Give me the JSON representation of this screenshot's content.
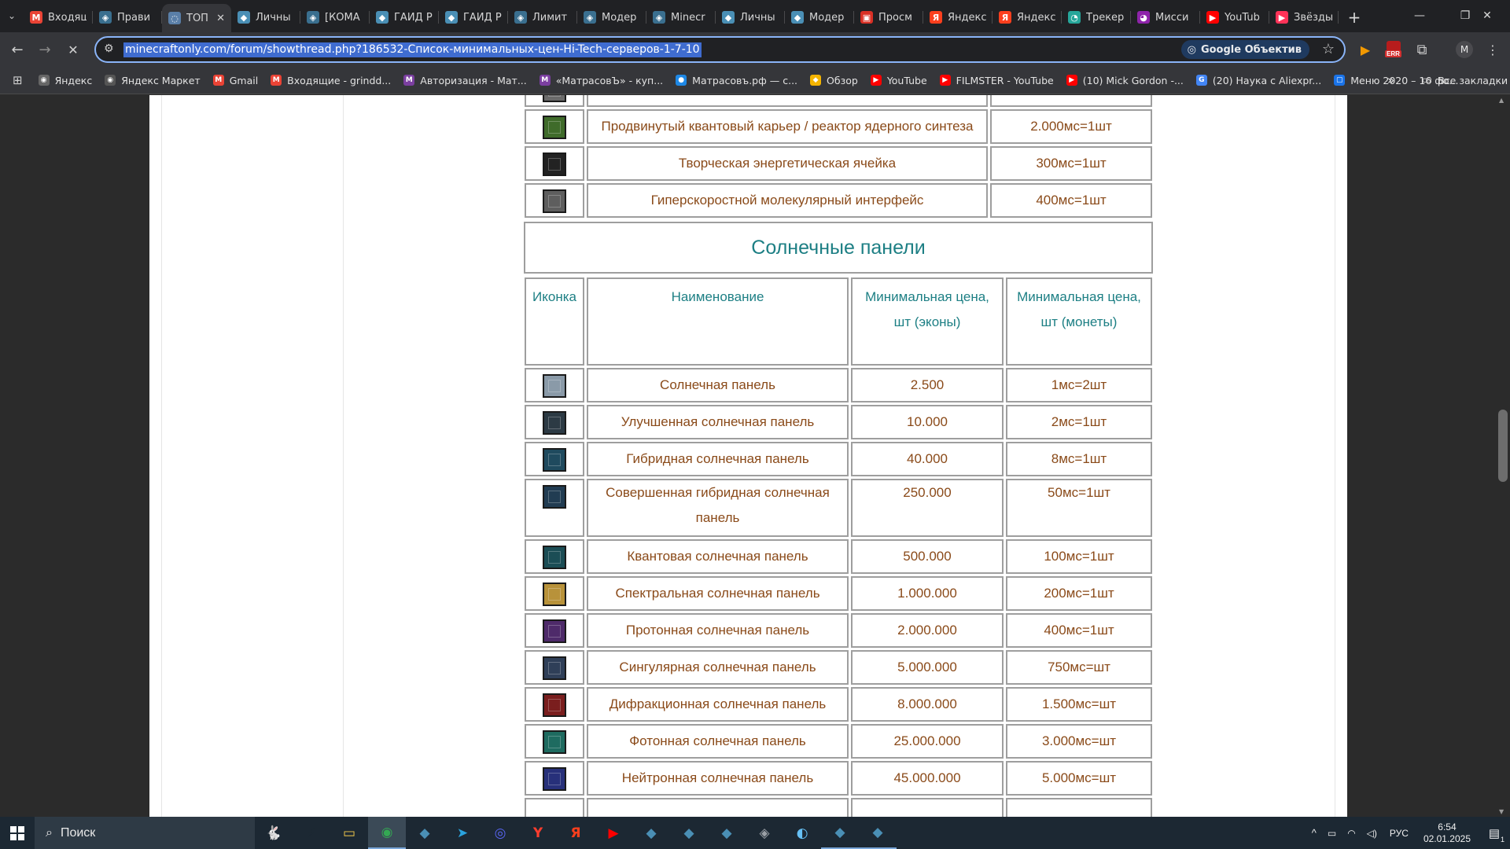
{
  "tabs": [
    {
      "label": "Входящ",
      "fav": "M",
      "color": "#ea4335"
    },
    {
      "label": "Прави",
      "fav": "◈",
      "color": "#3a6f8f"
    },
    {
      "label": "ТОП",
      "fav": "◌",
      "color": "#5a7fa8",
      "active": true
    },
    {
      "label": "Личны",
      "fav": "◆",
      "color": "#4a8fb5"
    },
    {
      "label": "[КОМА",
      "fav": "◈",
      "color": "#3a6f8f"
    },
    {
      "label": "ГАЙД Р",
      "fav": "◆",
      "color": "#4a8fb5"
    },
    {
      "label": "ГАЙД Р",
      "fav": "◆",
      "color": "#4a8fb5"
    },
    {
      "label": "Лимит",
      "fav": "◈",
      "color": "#3a6f8f"
    },
    {
      "label": "Модер",
      "fav": "◈",
      "color": "#3a6f8f"
    },
    {
      "label": "Minecr",
      "fav": "◈",
      "color": "#3a6f8f"
    },
    {
      "label": "Личны",
      "fav": "◆",
      "color": "#4a8fb5"
    },
    {
      "label": "Модер",
      "fav": "◆",
      "color": "#4a8fb5"
    },
    {
      "label": "Просм",
      "fav": "▣",
      "color": "#d93025"
    },
    {
      "label": "Яндекс",
      "fav": "Я",
      "color": "#fc3f1d"
    },
    {
      "label": "Яндекс",
      "fav": "Я",
      "color": "#fc3f1d"
    },
    {
      "label": "Трекер",
      "fav": "◔",
      "color": "#26a69a"
    },
    {
      "label": "Мисси",
      "fav": "◕",
      "color": "#8e24aa"
    },
    {
      "label": "YouTub",
      "fav": "▶",
      "color": "#ff0000"
    },
    {
      "label": "Звёзды",
      "fav": "▶",
      "color": "#ff3358"
    }
  ],
  "toolbar": {
    "url": "minecraftonly.com/forum/showthread.php?186532-Список-минимальных-цен-Hi-Tech-серверов-1-7-10",
    "lens_label": "Google Объектив",
    "profile_initial": "M",
    "ext_badge": "ERR"
  },
  "bookmarks": [
    {
      "label": "Яндекс",
      "fav": "◉",
      "color": "#666"
    },
    {
      "label": "Яндекс Маркет",
      "fav": "◉",
      "color": "#555"
    },
    {
      "label": "Gmail",
      "fav": "M",
      "color": "#ea4335"
    },
    {
      "label": "Входящие - grindd...",
      "fav": "M",
      "color": "#ea4335"
    },
    {
      "label": "Авторизация - Мат...",
      "fav": "M",
      "color": "#7b3fa0"
    },
    {
      "label": "«МатрасовЪ» - куп...",
      "fav": "M",
      "color": "#7b3fa0"
    },
    {
      "label": "Матрасовъ.рф — с...",
      "fav": "●",
      "color": "#1e88e5"
    },
    {
      "label": "Обзор",
      "fav": "◆",
      "color": "#f4b400"
    },
    {
      "label": "YouTube",
      "fav": "▶",
      "color": "#ff0000"
    },
    {
      "label": "FILMSTER - YouTube",
      "fav": "▶",
      "color": "#ff0000"
    },
    {
      "label": "(10) Mick Gordon -...",
      "fav": "▶",
      "color": "#ff0000"
    },
    {
      "label": "(20) Наука с Aliexpr...",
      "fav": "G",
      "color": "#4285f4"
    },
    {
      "label": "Меню 2020 – 16 фо...",
      "fav": "▢",
      "color": "#1a73e8"
    }
  ],
  "bookmarks_more": "»",
  "all_bookmarks": "Все закладки",
  "top_table": [
    {
      "name": "",
      "price": "",
      "color": "#6a6a6a"
    },
    {
      "name": "Продвинутый квантовый карьер / реактор ядерного синтеза",
      "price": "2.000мс=1шт",
      "color": "#3f6b2a"
    },
    {
      "name": "Творческая энергетическая ячейка",
      "price": "300мс=1шт",
      "color": "#222222"
    },
    {
      "name": "Гиперскоростной молекулярный интерфейс",
      "price": "400мс=1шт",
      "color": "#5e5e5e"
    }
  ],
  "solar": {
    "title": "Солнечные панели",
    "headers": {
      "icon": "Иконка",
      "name": "Наименование",
      "price_ecos": "Минимальная цена, шт (эконы)",
      "price_coins": "Минимальная цена, шт (монеты)"
    },
    "rows": [
      {
        "name": "Солнечная панель",
        "ecos": "2.500",
        "coins": "1мс=2шт",
        "color": "#8a9aa8"
      },
      {
        "name": "Улучшенная солнечная панель",
        "ecos": "10.000",
        "coins": "2мс=1шт",
        "color": "#2c3a44"
      },
      {
        "name": "Гибридная солнечная панель",
        "ecos": "40.000",
        "coins": "8мс=1шт",
        "color": "#1f4a5e"
      },
      {
        "name": "Совершенная гибридная солнечная панель",
        "ecos": "250.000",
        "coins": "50мс=1шт",
        "color": "#213c52"
      },
      {
        "name": "Квантовая солнечная панель",
        "ecos": "500.000",
        "coins": "100мс=1шт",
        "color": "#1b4d55"
      },
      {
        "name": "Спектральная солнечная панель",
        "ecos": "1.000.000",
        "coins": "200мс=1шт",
        "color": "#b8923a"
      },
      {
        "name": "Протонная солнечная панель",
        "ecos": "2.000.000",
        "coins": "400мс=1шт",
        "color": "#4e2a6a"
      },
      {
        "name": "Сингулярная солнечная панель",
        "ecos": "5.000.000",
        "coins": "750мс=шт",
        "color": "#2f3f58"
      },
      {
        "name": "Дифракционная солнечная панель",
        "ecos": "8.000.000",
        "coins": "1.500мс=шт",
        "color": "#7a1e1e"
      },
      {
        "name": "Фотонная солнечная панель",
        "ecos": "25.000.000",
        "coins": "3.000мс=шт",
        "color": "#1e6b60"
      },
      {
        "name": "Нейтронная солнечная панель",
        "ecos": "45.000.000",
        "coins": "5.000мс=шт",
        "color": "#27307a"
      }
    ]
  },
  "taskbar": {
    "search_label": "Поиск",
    "apps": [
      {
        "name": "taskbar-app-lively",
        "glyph": "🐇",
        "color": "#6b6f85"
      },
      {
        "name": "taskbar-app-winamp",
        "glyph": "⚡",
        "color": "#1c2833"
      },
      {
        "name": "taskbar-app-explorer",
        "glyph": "▭",
        "color": "#f2c94c"
      },
      {
        "name": "taskbar-app-chrome",
        "glyph": "◉",
        "color": "#34a853"
      },
      {
        "name": "taskbar-app-game1",
        "glyph": "◆",
        "color": "#4a8fb5"
      },
      {
        "name": "taskbar-app-telegram",
        "glyph": "➤",
        "color": "#2aa3de"
      },
      {
        "name": "taskbar-app-discord",
        "glyph": "◎",
        "color": "#5865f2"
      },
      {
        "name": "taskbar-app-yandex-browser",
        "glyph": "Y",
        "color": "#ff3d2e"
      },
      {
        "name": "taskbar-app-yandex",
        "glyph": "Я",
        "color": "#fc3f1d"
      },
      {
        "name": "taskbar-app-youtube",
        "glyph": "▶",
        "color": "#ff0000"
      },
      {
        "name": "taskbar-app-game2",
        "glyph": "◆",
        "color": "#4a8fb5"
      },
      {
        "name": "taskbar-app-game3",
        "glyph": "◆",
        "color": "#4a8fb5"
      },
      {
        "name": "taskbar-app-game4",
        "glyph": "◆",
        "color": "#4a8fb5"
      },
      {
        "name": "taskbar-app-shield",
        "glyph": "◈",
        "color": "#9aa0a6"
      },
      {
        "name": "taskbar-app-steam",
        "glyph": "◐",
        "color": "#66c0f4"
      },
      {
        "name": "taskbar-app-game5",
        "glyph": "◆",
        "color": "#4a8fb5"
      },
      {
        "name": "taskbar-app-game6",
        "glyph": "◆",
        "color": "#4a8fb5"
      }
    ],
    "lang": "РУС",
    "time": "6:54",
    "date": "02.01.2025",
    "notifications": "1"
  }
}
